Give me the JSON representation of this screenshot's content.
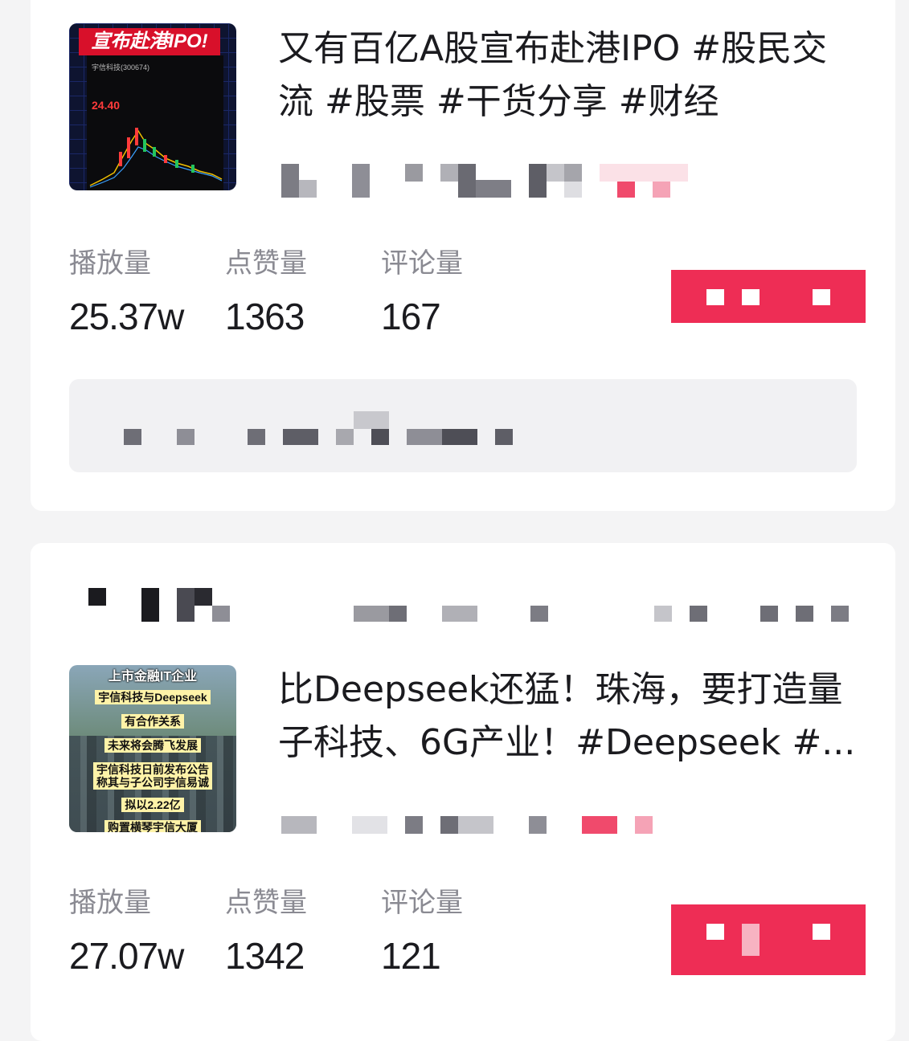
{
  "posts": [
    {
      "thumbnail": {
        "banner": "宣布赴港IPO!",
        "ticker": "宇信科技(300674)",
        "price": "24.40"
      },
      "title": "又有百亿A股宣布赴港IPO #股民交流 #股票 #干货分享 #财经",
      "stats": {
        "plays_label": "播放量",
        "plays_value": "25.37w",
        "likes_label": "点赞量",
        "likes_value": "1363",
        "comments_label": "评论量",
        "comments_value": "167"
      }
    },
    {
      "thumbnail": {
        "caption_lines": [
          "上市金融IT企业",
          "宇信科技与Deepseek",
          "有合作关系",
          "未来将会腾飞发展",
          "宇信科技日前发布公告",
          "称其与子公司宇信易诚",
          "拟以2.22亿",
          "购置横琴宇信大厦"
        ]
      },
      "title": "比Deepseek还猛！珠海，要打造量子科技、6G产业！#Deepseek #...",
      "stats": {
        "plays_label": "播放量",
        "plays_value": "27.07w",
        "likes_label": "点赞量",
        "likes_value": "1342",
        "comments_label": "评论量",
        "comments_value": "121"
      }
    }
  ],
  "colors": {
    "accent": "#ee2d55",
    "text_primary": "#1b1b1f",
    "text_secondary": "#8a8a92",
    "background": "#f4f4f5",
    "card": "#ffffff"
  }
}
